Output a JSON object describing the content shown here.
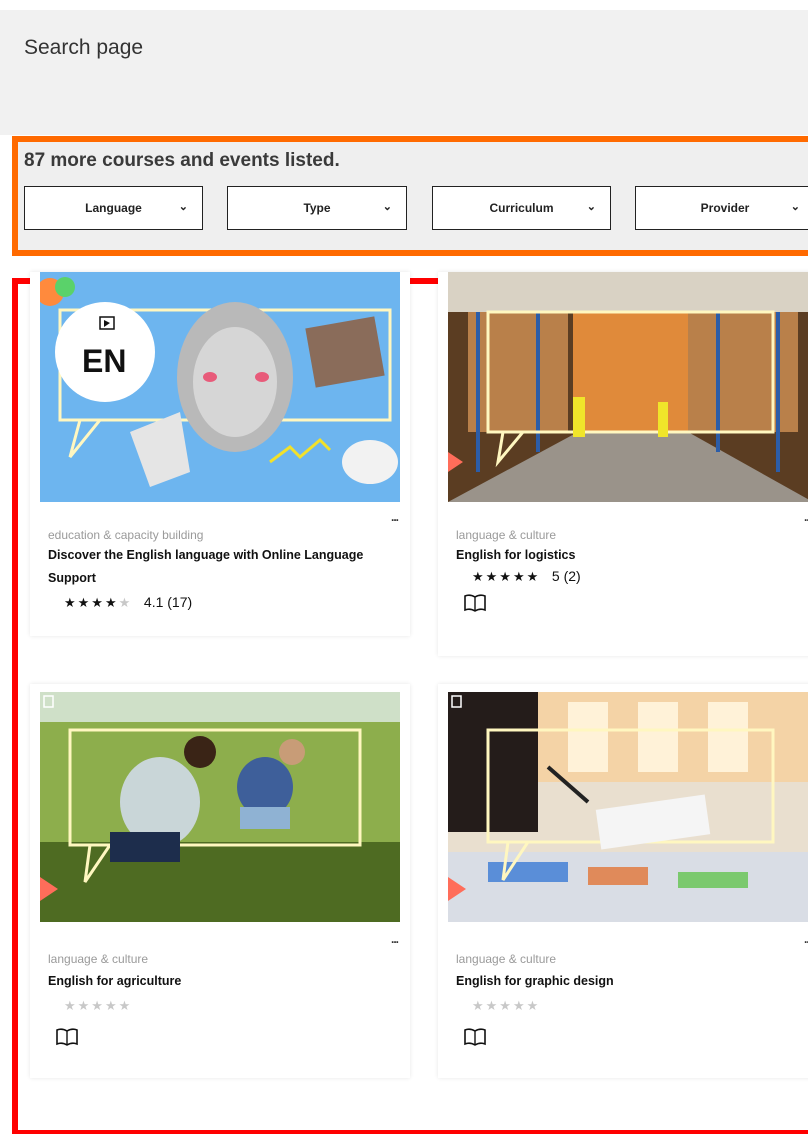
{
  "header": {
    "title": "Search page"
  },
  "filters": {
    "count_text": "87 more courses and events listed.",
    "dropdowns": [
      {
        "label": "Language"
      },
      {
        "label": "Type"
      },
      {
        "label": "Curriculum"
      },
      {
        "label": "Provider"
      }
    ]
  },
  "cards": [
    {
      "category": "education & capacity building",
      "title": "Discover the English language with Online Language Support",
      "rating": 4.1,
      "stars_filled": 4,
      "rating_text": "4.1 (17)",
      "image_badge": "EN",
      "menu": "..."
    },
    {
      "category": "language & culture",
      "title": "English for logistics",
      "rating": 5,
      "stars_filled": 5,
      "rating_text": "5 (2)",
      "menu": "..."
    },
    {
      "category": "language & culture",
      "title": "English for agriculture",
      "rating": 0,
      "stars_filled": 0,
      "rating_text": "",
      "menu": "..."
    },
    {
      "category": "language & culture",
      "title": "English for graphic design",
      "rating": 0,
      "stars_filled": 0,
      "rating_text": "",
      "menu": "..."
    }
  ],
  "icons": {
    "chevron": "chevron-down-icon",
    "book": "book-icon",
    "bookmark": "bookmark-icon",
    "video": "video-icon"
  },
  "colors": {
    "filter_border": "#ff6a00",
    "results_border": "#ff0000",
    "header_bg": "#f1f1f1"
  }
}
